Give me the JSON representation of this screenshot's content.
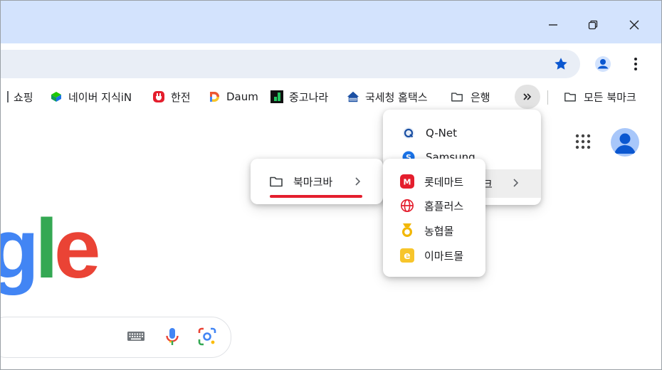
{
  "colors": {
    "titlebar": "#d3e3fd",
    "omnibox": "#e9eef6",
    "accent_blue": "#0b57d0",
    "google_blue": "#4285f4",
    "google_green": "#34a853",
    "google_red": "#ea4335",
    "annotation_red": "#e41e2d"
  },
  "window_controls": [
    {
      "icon": "minimize-icon"
    },
    {
      "icon": "restore-icon"
    },
    {
      "icon": "close-icon"
    }
  ],
  "toolbar": {
    "star_icon": "star-icon",
    "profile_icon": "profile-icon",
    "menu_icon": "kebab-menu-icon"
  },
  "bookmarks_bar": {
    "items": [
      {
        "label": "쇼핑",
        "icon": "none"
      },
      {
        "label": "네이버 지식iN",
        "icon": "naver-kin-icon"
      },
      {
        "label": "한전",
        "icon": "kepco-icon"
      },
      {
        "label": "Daum",
        "icon": "daum-icon"
      },
      {
        "label": "중고나라",
        "icon": "joonggonara-icon"
      },
      {
        "label": "국세청 홈택스",
        "icon": "hometax-icon"
      },
      {
        "label": "은행",
        "icon": "folder-icon"
      }
    ],
    "overflow_icon": "double-chevron-right-icon",
    "all_bookmarks": "모든 북마크"
  },
  "google_logo_visible": "gle",
  "overflow_menu": {
    "items": [
      {
        "label": "Q-Net",
        "icon": "qnet-icon"
      },
      {
        "label": "Samsung",
        "icon": "samsung-icon"
      },
      {
        "label": "크",
        "icon": "folder-icon"
      }
    ]
  },
  "submenu_bookmarkbar": {
    "label": "북마크바"
  },
  "submenu_shopping": {
    "items": [
      {
        "label": "롯데마트",
        "icon": "lottemart-icon",
        "color": "#e41e2d"
      },
      {
        "label": "홈플러스",
        "icon": "homeplus-icon",
        "color": "#e41e2d"
      },
      {
        "label": "농협몰",
        "icon": "nhmall-icon",
        "color": "#f2b705"
      },
      {
        "label": "이마트몰",
        "icon": "emart-icon",
        "color": "#f7c52b"
      }
    ]
  }
}
